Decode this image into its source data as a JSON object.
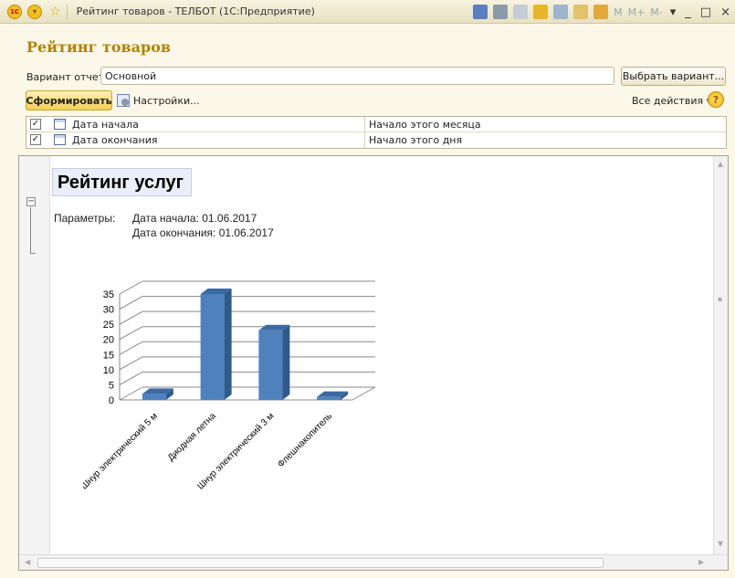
{
  "window": {
    "title": "Рейтинг товаров - ТЕЛБОТ  (1С:Предприятие)",
    "toolbar_letters": [
      "M",
      "M+",
      "M-"
    ]
  },
  "header": {
    "page_title": "Рейтинг товаров",
    "variant_label": "Вариант отчета:",
    "variant_value": "Основной",
    "select_variant_label": "Выбрать вариант...",
    "generate_label": "Сформировать",
    "settings_label": "Настройки...",
    "all_actions_label": "Все действия ▾"
  },
  "settings": {
    "rows": [
      {
        "checked": "✓",
        "name": "Дата начала",
        "value": "Начало этого месяца"
      },
      {
        "checked": "✓",
        "name": "Дата окончания",
        "value": "Начало этого дня"
      }
    ]
  },
  "report": {
    "title": "Рейтинг услуг",
    "params_label": "Параметры:",
    "param_start": "Дата начала: 01.06.2017",
    "param_end": "Дата окончания: 01.06.2017"
  },
  "colors": {
    "bar_front": "#4f81bd",
    "bar_side": "#2f5a8c",
    "bar_top": "#3b6aa3",
    "title_gold": "#b38200"
  },
  "chart_data": {
    "type": "bar",
    "categories": [
      "Шнур электрический 5 м",
      "Диодная летна",
      "Шнур электрический 3 м",
      "Флешнакопитель"
    ],
    "values": [
      2,
      35,
      23,
      1
    ],
    "ylim": [
      0,
      35
    ],
    "yticks": [
      0,
      5,
      10,
      15,
      20,
      25,
      30,
      35
    ],
    "grid": true
  }
}
